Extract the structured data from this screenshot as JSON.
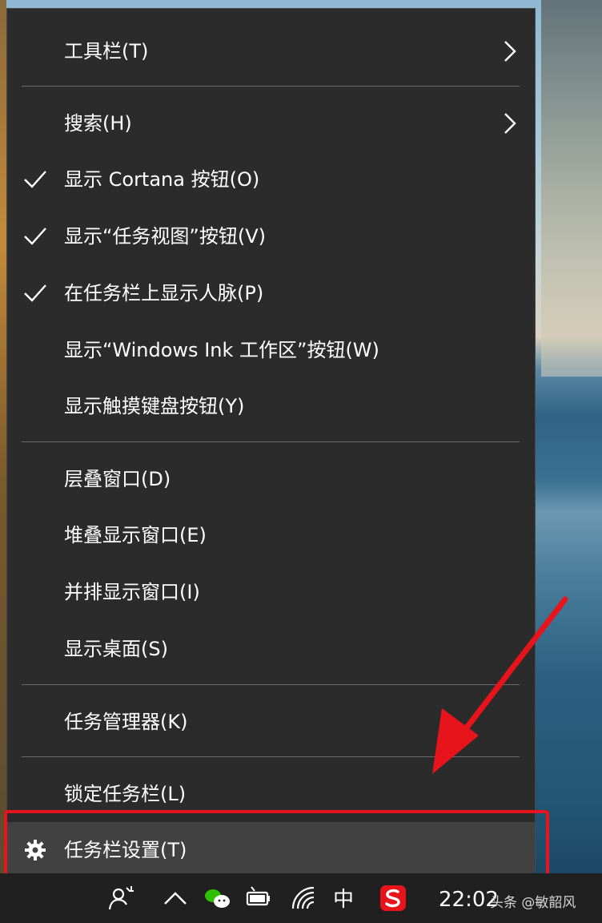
{
  "menu": {
    "items": [
      {
        "label": "工具栏(T)",
        "checked": false,
        "submenu": true
      },
      {
        "label": "搜索(H)",
        "checked": false,
        "submenu": true
      },
      {
        "label": "显示 Cortana 按钮(O)",
        "checked": true,
        "submenu": false
      },
      {
        "label": "显示“任务视图”按钮(V)",
        "checked": true,
        "submenu": false
      },
      {
        "label": "在任务栏上显示人脉(P)",
        "checked": true,
        "submenu": false
      },
      {
        "label": "显示“Windows Ink 工作区”按钮(W)",
        "checked": false,
        "submenu": false
      },
      {
        "label": "显示触摸键盘按钮(Y)",
        "checked": false,
        "submenu": false
      },
      {
        "label": "层叠窗口(D)",
        "checked": false,
        "submenu": false
      },
      {
        "label": "堆叠显示窗口(E)",
        "checked": false,
        "submenu": false
      },
      {
        "label": "并排显示窗口(I)",
        "checked": false,
        "submenu": false
      },
      {
        "label": "显示桌面(S)",
        "checked": false,
        "submenu": false
      },
      {
        "label": "任务管理器(K)",
        "checked": false,
        "submenu": false
      },
      {
        "label": "锁定任务栏(L)",
        "checked": false,
        "submenu": false
      },
      {
        "label": "任务栏设置(T)",
        "checked": false,
        "submenu": false,
        "icon": "gear-icon",
        "highlighted": true
      }
    ]
  },
  "taskbar": {
    "ime_label": "中",
    "clock": "22:02",
    "icons": [
      "people-icon",
      "chevron-up-icon",
      "wechat-icon",
      "battery-icon",
      "wifi-icon",
      "sogou-ime-icon"
    ]
  },
  "watermark": "头条 @敏韶风",
  "colors": {
    "menu_bg": "#2b2b2b",
    "highlight_bg": "#414141",
    "annotation_red": "#e8141c"
  }
}
